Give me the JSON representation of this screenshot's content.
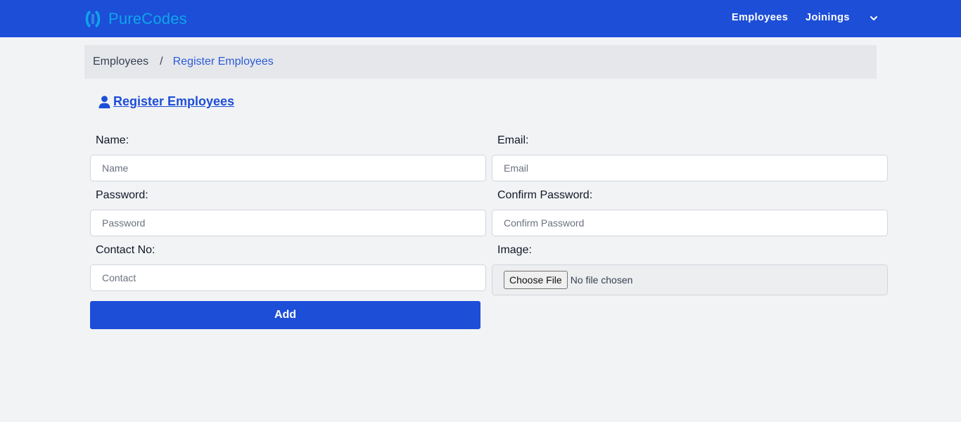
{
  "navbar": {
    "brand": "PureCodes",
    "links": [
      "Employees",
      "Joinings"
    ],
    "dropdown_icon": "chevron-down-icon",
    "background": "#1d4ed8",
    "brand_color": "#0ea5e9"
  },
  "breadcrumb": {
    "home": "Employees",
    "separator": "/",
    "current": "Register Employees"
  },
  "page": {
    "title": "Register Employees",
    "title_icon": "user-icon"
  },
  "form": {
    "name_label": "Name:",
    "name_placeholder": "Name",
    "email_label": "Email:",
    "email_placeholder": "Email",
    "password_label": "Password:",
    "password_placeholder": "Password",
    "confirm_label": "Confirm Password:",
    "confirm_placeholder": "Confirm Password",
    "contact_label": "Contact No:",
    "contact_placeholder": "Contact",
    "image_label": "Image:",
    "file_button": "Choose File",
    "file_status": "No file chosen",
    "submit_label": "Add"
  }
}
